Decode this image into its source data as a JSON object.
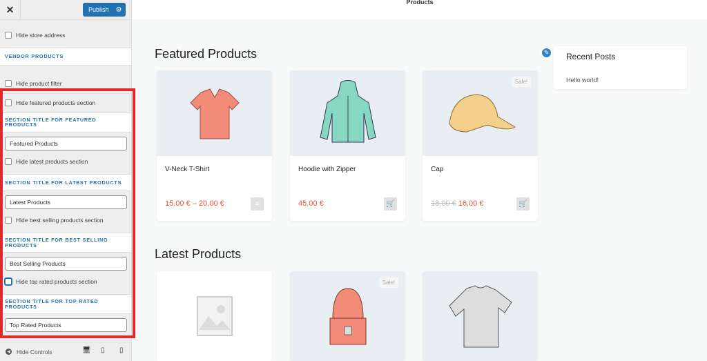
{
  "panel": {
    "publish_label": "Publish",
    "close_icon": "close-icon",
    "items": {
      "hide_store_address": "Hide store address",
      "vendor_products": "VENDOR PRODUCTS",
      "hide_product_filter": "Hide product filter",
      "hide_featured": "Hide featured products section",
      "featured_title_label": "SECTION TITLE FOR FEATURED PRODUCTS",
      "featured_title_value": "Featured Products",
      "hide_latest": "Hide latest products section",
      "latest_title_label": "SECTION TITLE FOR LATEST PRODUCTS",
      "latest_title_value": "Latest Products",
      "hide_best": "Hide best selling products section",
      "best_title_label": "SECTION TITLE FOR BEST SELLING PRODUCTS",
      "best_title_value": "Best Selling Products",
      "hide_top": "Hide top rated products section",
      "top_title_label": "SECTION TITLE FOR TOP RATED PRODUCTS",
      "top_title_value": "Top Rated Products"
    },
    "hide_controls": "Hide Controls"
  },
  "preview": {
    "header_text": "Products",
    "featured_title": "Featured Products",
    "latest_title": "Latest Products",
    "featured": [
      {
        "name": "V-Neck T-Shirt",
        "price": "15,00 € – 20,00 €",
        "old_price": "",
        "sale": ""
      },
      {
        "name": "Hoodie with Zipper",
        "price": "45,00 €",
        "old_price": "",
        "sale": ""
      },
      {
        "name": "Cap",
        "price": "16,00 €",
        "old_price": "18,00 €",
        "sale": "Sale!"
      }
    ],
    "latest_sale": "Sale!",
    "widget": {
      "title": "Recent Posts",
      "link": "Hello world!"
    }
  }
}
